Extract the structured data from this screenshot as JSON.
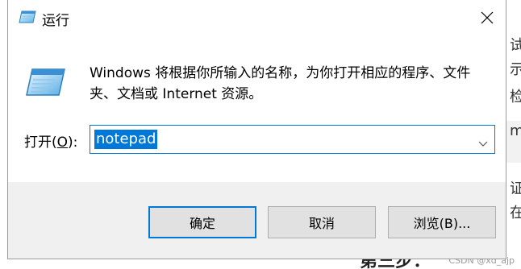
{
  "dialog": {
    "title": "运行",
    "description": "Windows 将根据你所输入的名称，为你打开相应的程序、文件夹、文档或 Internet 资源。",
    "open_label_prefix": "打开(",
    "open_label_key": "O",
    "open_label_suffix": "):",
    "input_value": "notepad",
    "buttons": {
      "ok": "确定",
      "cancel": "取消",
      "browse": "浏览(B)..."
    }
  },
  "background": {
    "fragments": [
      "试",
      "示",
      "检",
      "m",
      "证",
      "在"
    ],
    "heading": "第三步：",
    "watermark": "CSDN @xd_ajp"
  },
  "colors": {
    "accent": "#0078d7",
    "footer": "#f0f0f0",
    "button": "#e1e1e1"
  }
}
